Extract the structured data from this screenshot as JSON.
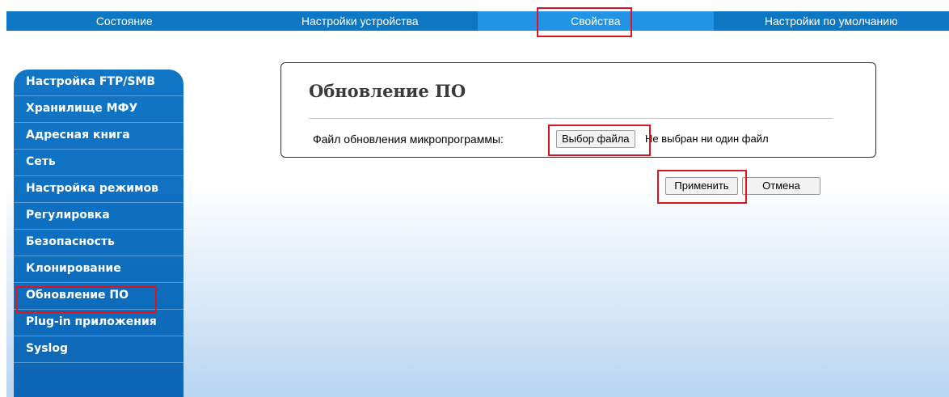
{
  "topnav": {
    "tabs": [
      {
        "label": "Состояние"
      },
      {
        "label": "Настройки устройства"
      },
      {
        "label": "Свойства"
      },
      {
        "label": "Настройки по умолчанию"
      }
    ]
  },
  "sidebar": {
    "items": [
      {
        "label": "Настройка FTP/SMB"
      },
      {
        "label": "Хранилище МФУ"
      },
      {
        "label": "Адресная книга"
      },
      {
        "label": "Сеть"
      },
      {
        "label": "Настройка режимов"
      },
      {
        "label": "Регулировка"
      },
      {
        "label": "Безопасность"
      },
      {
        "label": "Клонирование"
      },
      {
        "label": "Обновление ПО"
      },
      {
        "label": "Plug-in приложения"
      },
      {
        "label": "Syslog"
      }
    ]
  },
  "panel": {
    "title": "Обновление ПО",
    "file_label": "Файл обновления микропрограммы:",
    "choose_button": "Выбор файла",
    "no_file_text": "Не выбран ни один файл"
  },
  "actions": {
    "apply_label": "Применить",
    "cancel_label": "Отмена"
  },
  "colors": {
    "nav_blue": "#0d77c4",
    "nav_active": "#2393e6",
    "sidebar_blue": "#0f6fc0",
    "highlight_red": "#e0141e"
  }
}
